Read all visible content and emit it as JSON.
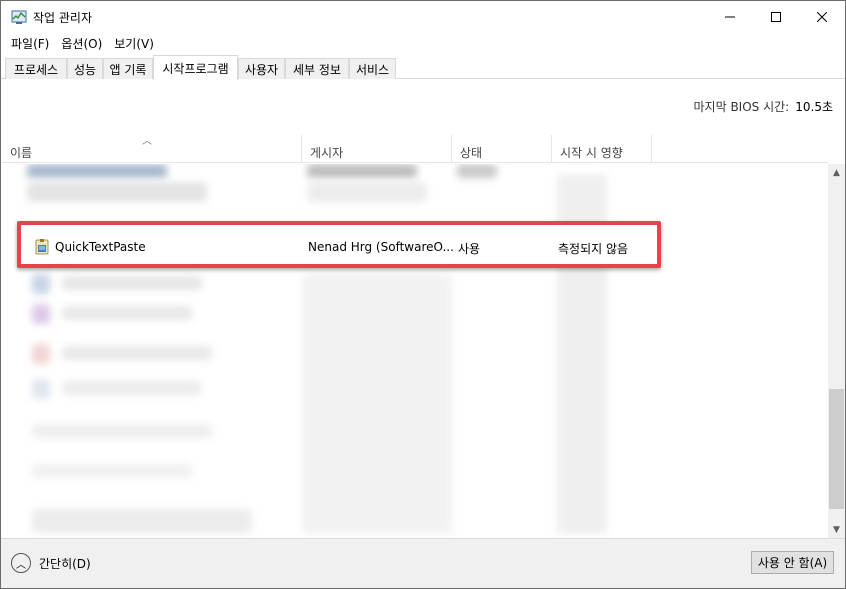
{
  "window": {
    "title": "작업 관리자"
  },
  "menu": {
    "items": [
      "파일(F)",
      "옵션(O)",
      "보기(V)"
    ]
  },
  "tabs": [
    "프로세스",
    "성능",
    "앱 기록",
    "시작프로그램",
    "사용자",
    "세부 정보",
    "서비스"
  ],
  "active_tab": "시작프로그램",
  "bios": {
    "label": "마지막 BIOS 시간:",
    "value": "10.5초"
  },
  "columns": [
    "이름",
    "게시자",
    "상태",
    "시작 시 영향"
  ],
  "highlighted_row": {
    "name": "QuickTextPaste",
    "publisher": "Nenad Hrg (SoftwareO...",
    "status": "사용",
    "impact": "측정되지 않음"
  },
  "footer": {
    "fewer_details": "간단히(D)",
    "disable_button": "사용 안 함(A)"
  },
  "colors": {
    "highlight_border": "#e8424a",
    "thumb": "#cdcdcd"
  },
  "icons": {
    "app": "task-manager-icon",
    "row": "quicktextpaste-icon",
    "sort": "sort-up-arrow",
    "fewer": "chevron-up-circle-icon"
  }
}
